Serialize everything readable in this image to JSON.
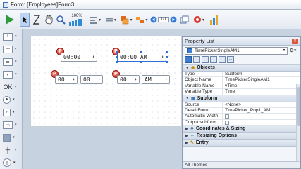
{
  "window": {
    "title": "Form: [Employees]Form3"
  },
  "toolbar": {
    "zoom_label": "100%",
    "page_indicator": "1/1"
  },
  "form": {
    "pickers": [
      {
        "badge": "P",
        "value": "00:00",
        "spin": "⬍"
      },
      {
        "badge": "P",
        "value": "00:00 AM",
        "spin": "⬍"
      }
    ],
    "picker_row2": [
      {
        "badge": "P",
        "hours": "00",
        "minutes": "00",
        "spin": "⬍"
      },
      {
        "badge": "P",
        "hours": "00",
        "ampm": "AM",
        "spin": "⬍"
      }
    ]
  },
  "property_list": {
    "title": "Property List",
    "close": "✕",
    "selected_object": "TimePickerSingleAM1",
    "footer": "All Themes",
    "sections": [
      {
        "label": "Objects",
        "expanded": true,
        "rows": [
          {
            "key": "Type",
            "value": "Subform"
          },
          {
            "key": "Object Name",
            "value": "TimePickerSingleAM1"
          },
          {
            "key": "Variable Name",
            "value": "vTime"
          },
          {
            "key": "Variable Type",
            "value": "Time"
          }
        ]
      },
      {
        "label": "Subform",
        "expanded": true,
        "rows": [
          {
            "key": "Source",
            "value": "<None>"
          },
          {
            "key": "Detail Form",
            "value": "TimePicker_Pop1_AM"
          },
          {
            "key": "Automatic Width",
            "value": "",
            "checkbox": true
          },
          {
            "key": "Output subform",
            "value": "",
            "checkbox": true
          }
        ]
      },
      {
        "label": "Coordinates & Sizing",
        "expanded": false
      },
      {
        "label": "Resizing Options",
        "expanded": false
      },
      {
        "label": "Entry",
        "expanded": false
      }
    ]
  }
}
